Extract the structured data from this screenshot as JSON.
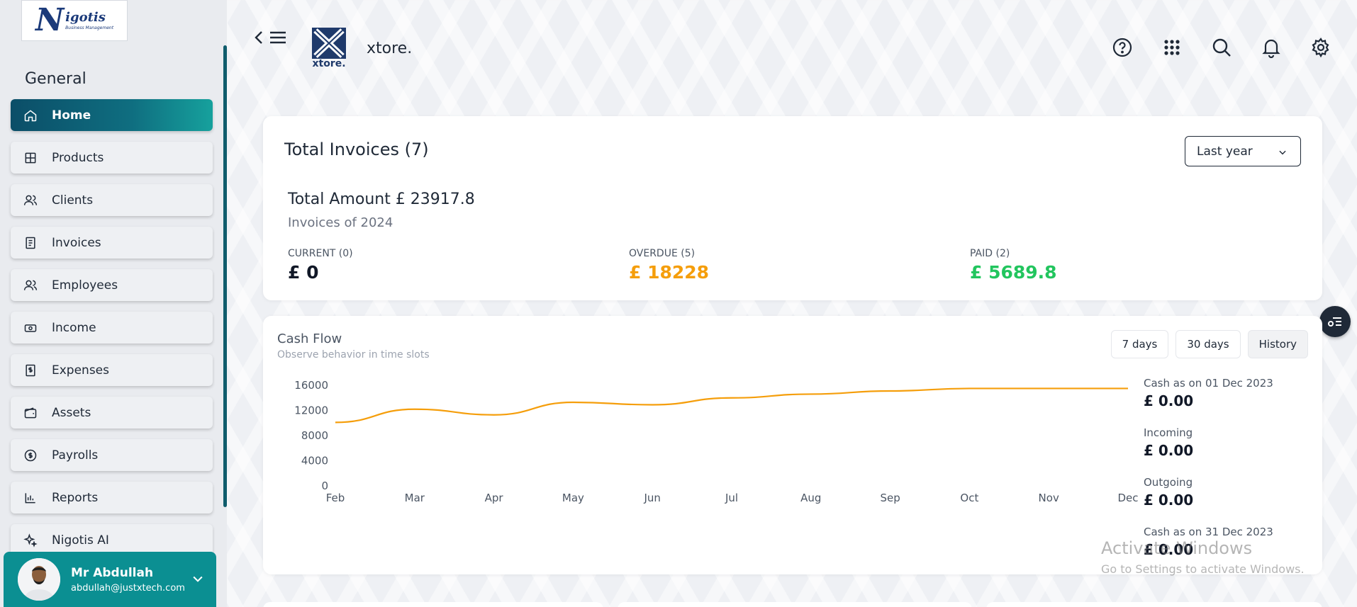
{
  "sidebar": {
    "logo": {
      "mark": "N",
      "name": "igotis",
      "tagline": "Business Management"
    },
    "section_title": "General",
    "items": [
      {
        "label": "Home",
        "icon": "home-icon",
        "active": true
      },
      {
        "label": "Products",
        "icon": "grid-icon"
      },
      {
        "label": "Clients",
        "icon": "users-icon"
      },
      {
        "label": "Invoices",
        "icon": "document-icon"
      },
      {
        "label": "Employees",
        "icon": "users-icon"
      },
      {
        "label": "Income",
        "icon": "cash-icon"
      },
      {
        "label": "Expenses",
        "icon": "dollar-doc-icon"
      },
      {
        "label": "Assets",
        "icon": "wallet-icon"
      },
      {
        "label": "Payrolls",
        "icon": "coin-icon"
      },
      {
        "label": "Reports",
        "icon": "bar-chart-icon"
      },
      {
        "label": "Nigotis AI",
        "icon": "sparkle-icon"
      }
    ],
    "user": {
      "name": "Mr Abdullah",
      "email": "abdullah@justxtech.com"
    }
  },
  "topbar": {
    "brand_sub": "xtore.",
    "brand_title": "xtore.",
    "icons": [
      "help-icon",
      "apps-icon",
      "search-icon",
      "bell-icon",
      "gear-icon"
    ]
  },
  "invoices": {
    "title": "Total Invoices (7)",
    "period": "Last year",
    "total_amount": "Total Amount £ 23917.8",
    "subtitle": "Invoices of 2024",
    "current": {
      "label": "CURRENT (0)",
      "value": "£ 0",
      "color": "#111827"
    },
    "overdue": {
      "label": "OVERDUE (5)",
      "value": "£ 18228",
      "color": "#f59e0b"
    },
    "paid": {
      "label": "PAID (2)",
      "value": "£ 5689.8",
      "color": "#22c55e"
    }
  },
  "cashflow": {
    "title": "Cash Flow",
    "subtitle": "Observe behavior in time slots",
    "ranges": [
      "7 days",
      "30 days",
      "History"
    ],
    "selected_range": "History",
    "side": [
      {
        "label": "Cash as on 01 Dec 2023",
        "value": "£ 0.00"
      },
      {
        "label": "Incoming",
        "value": "£ 0.00"
      },
      {
        "label": "Outgoing",
        "value": "£ 0.00"
      },
      {
        "label": "Cash as on 31 Dec 2023",
        "value": "£ 0.00"
      }
    ]
  },
  "chart_data": {
    "type": "line",
    "categories": [
      "Feb",
      "Mar",
      "Apr",
      "May",
      "Jun",
      "Jul",
      "Aug",
      "Sep",
      "Oct",
      "Nov",
      "Dec"
    ],
    "series": [
      {
        "values": [
          10100,
          12200,
          11300,
          13300,
          12900,
          14000,
          14600,
          15100,
          15500,
          15500,
          15500
        ],
        "color": "#f59e0b"
      }
    ],
    "yticks": [
      0,
      4000,
      8000,
      12000,
      16000
    ],
    "ylim": [
      0,
      16000
    ],
    "grid": false,
    "legend": "none"
  },
  "watermark": {
    "title": "Activate Windows",
    "subtitle": "Go to Settings to activate Windows."
  }
}
